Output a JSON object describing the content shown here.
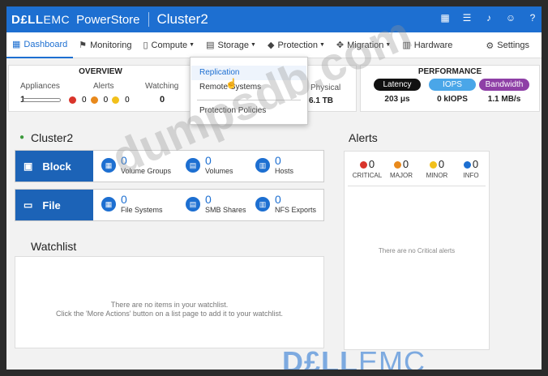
{
  "topbar": {
    "logo": "D£LL",
    "logo_suffix": "EMC",
    "product": "PowerStore",
    "cluster": "Cluster2",
    "icons": [
      "grid-icon",
      "list-icon",
      "bell-icon",
      "user-icon",
      "help-icon"
    ]
  },
  "nav": {
    "items": [
      {
        "label": "Dashboard",
        "icon": "dashboard-icon"
      },
      {
        "label": "Monitoring",
        "icon": "flag-icon"
      },
      {
        "label": "Compute",
        "icon": "compute-icon"
      },
      {
        "label": "Storage",
        "icon": "storage-icon"
      },
      {
        "label": "Protection",
        "icon": "shield-icon"
      },
      {
        "label": "Migration",
        "icon": "migration-icon"
      },
      {
        "label": "Hardware",
        "icon": "hardware-icon"
      }
    ],
    "settings": "Settings"
  },
  "overview": {
    "title": "OVERVIEW",
    "appliances_label": "Appliances",
    "appliances_value": "1",
    "alerts_label": "Alerts",
    "alerts": [
      "0",
      "0",
      "0"
    ],
    "watching_label": "Watching",
    "watching_value": "0"
  },
  "capacity": {
    "physical_label": "Physical",
    "physical_value": "6.1 TB"
  },
  "performance": {
    "title": "PERFORMANCE",
    "latency_label": "Latency",
    "latency_value": "203 μs",
    "iops_label": "IOPS",
    "iops_value": "0 kIOPS",
    "bandwidth_label": "Bandwidth",
    "bandwidth_value": "1.1 MB/s"
  },
  "cluster": {
    "name": "Cluster2",
    "block": {
      "label": "Block",
      "metrics": [
        {
          "value": "0",
          "label": "Volume Groups"
        },
        {
          "value": "0",
          "label": "Volumes"
        },
        {
          "value": "0",
          "label": "Hosts"
        }
      ]
    },
    "file": {
      "label": "File",
      "metrics": [
        {
          "value": "0",
          "label": "File Systems"
        },
        {
          "value": "0",
          "label": "SMB Shares"
        },
        {
          "value": "0",
          "label": "NFS Exports"
        }
      ]
    }
  },
  "watchlist": {
    "title": "Watchlist",
    "line1": "There are no items in your watchlist.",
    "line2": "Click the 'More Actions' button on a list page to add it to your watchlist."
  },
  "alerts_panel": {
    "title": "Alerts",
    "counts": [
      {
        "value": "0",
        "label": "CRITICAL",
        "color": "#d9342b"
      },
      {
        "value": "0",
        "label": "MAJOR",
        "color": "#e8891c"
      },
      {
        "value": "0",
        "label": "MINOR",
        "color": "#f2c01b"
      },
      {
        "value": "0",
        "label": "INFO",
        "color": "#1d6fd1"
      }
    ],
    "empty": "There are no Critical alerts"
  },
  "dropdown": {
    "items": [
      "Replication",
      "Remote Systems",
      "Protection Policies"
    ]
  },
  "watermark": "dumpsdb.com",
  "brand_watermark_bold": "D£LL",
  "brand_watermark_rest": "EMC",
  "colors": {
    "accent": "#1d6fd1",
    "latency": "#111111",
    "iops": "#4aa6e8",
    "bandwidth": "#8e3fa6"
  }
}
